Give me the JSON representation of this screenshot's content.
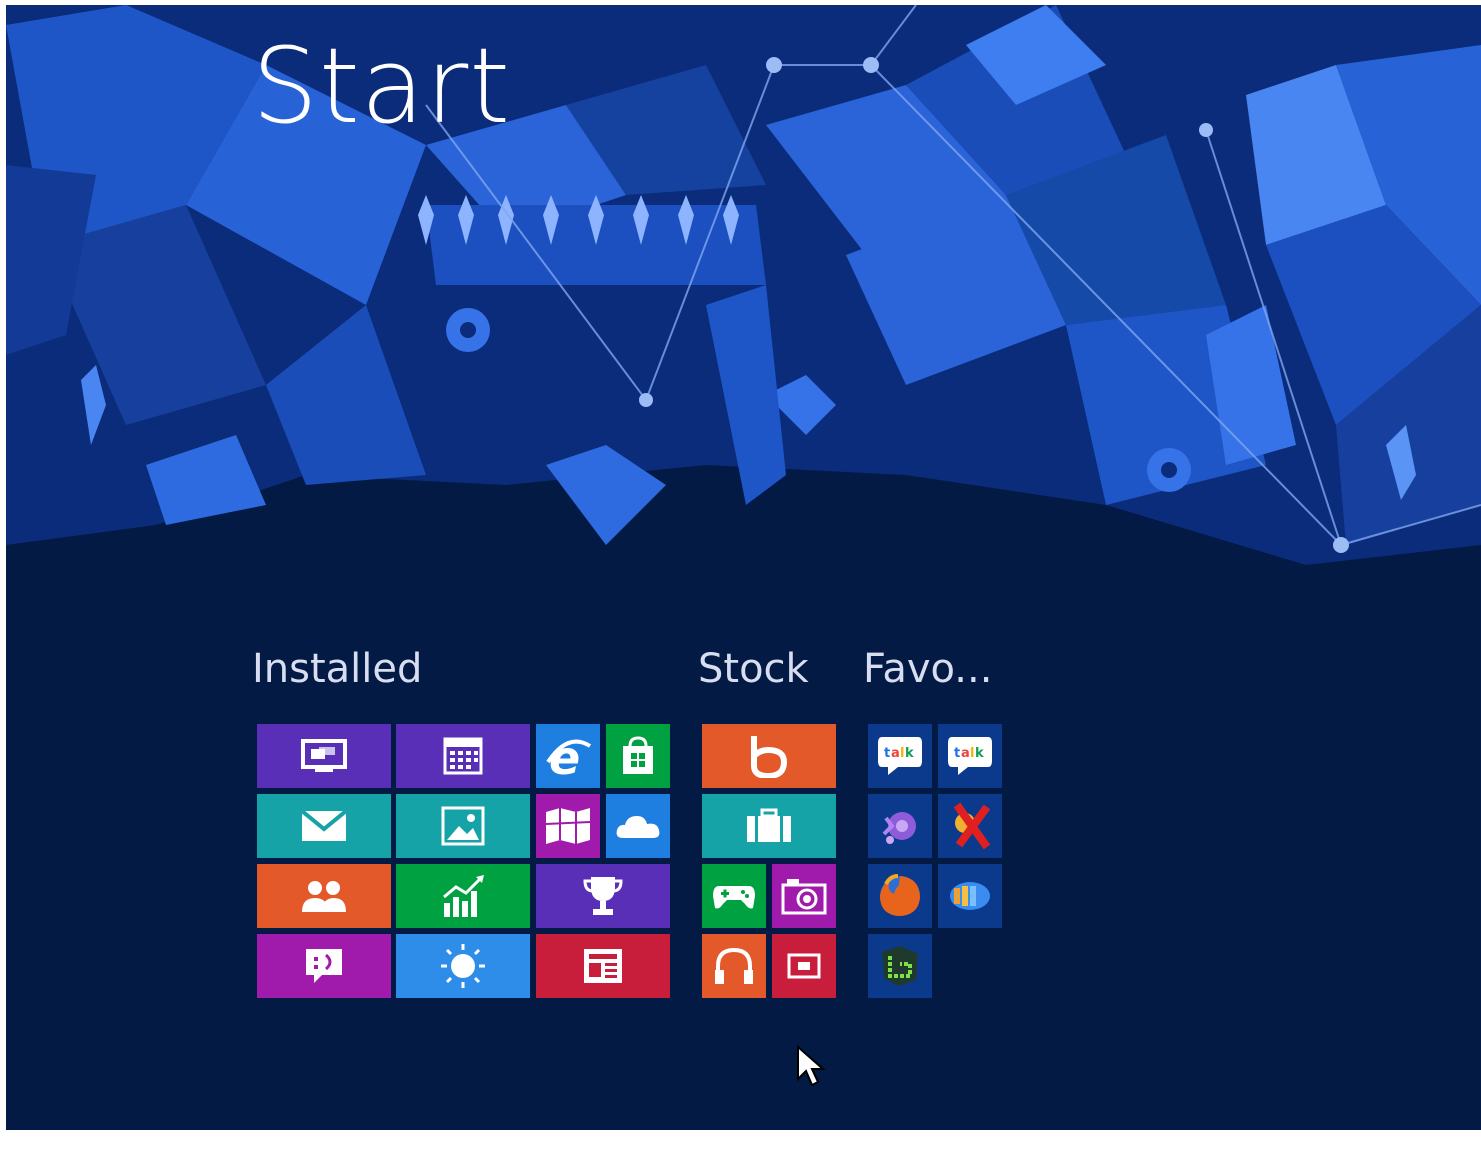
{
  "start": {
    "title": "Start"
  },
  "groups": [
    {
      "id": "installed",
      "label": "Installed"
    },
    {
      "id": "stock",
      "label": "Stock"
    },
    {
      "id": "favorites",
      "label": "Favo..."
    }
  ],
  "tiles": {
    "installed": [
      {
        "name": "desktop",
        "icon": "desktop-icon",
        "color": "#5a2fb7"
      },
      {
        "name": "calendar",
        "icon": "calendar-icon",
        "color": "#5a2fb7"
      },
      {
        "name": "internet-explorer",
        "icon": "ie-icon",
        "color": "#1f7fe0"
      },
      {
        "name": "store",
        "icon": "store-icon",
        "color": "#00a140"
      },
      {
        "name": "mail",
        "icon": "mail-icon",
        "color": "#16a3a8"
      },
      {
        "name": "photos",
        "icon": "photos-icon",
        "color": "#16a3a8"
      },
      {
        "name": "maps",
        "icon": "maps-icon",
        "color": "#a01bab"
      },
      {
        "name": "skydrive",
        "icon": "cloud-icon",
        "color": "#1f7fe0"
      },
      {
        "name": "people",
        "icon": "people-icon",
        "color": "#e4592a"
      },
      {
        "name": "finance",
        "icon": "chart-icon",
        "color": "#00a140"
      },
      {
        "name": "sports",
        "icon": "trophy-icon",
        "color": "#5a2fb7"
      },
      {
        "name": "messaging",
        "icon": "messaging-icon",
        "color": "#a01bab"
      },
      {
        "name": "weather",
        "icon": "sun-icon",
        "color": "#2e8de8"
      },
      {
        "name": "news",
        "icon": "news-icon",
        "color": "#c81e3c"
      }
    ],
    "stock": [
      {
        "name": "bing",
        "icon": "bing-icon",
        "color": "#e4592a"
      },
      {
        "name": "travel",
        "icon": "suitcase-icon",
        "color": "#16a3a8"
      },
      {
        "name": "games",
        "icon": "gamepad-icon",
        "color": "#00a140"
      },
      {
        "name": "camera",
        "icon": "camera-icon",
        "color": "#a01bab"
      },
      {
        "name": "music",
        "icon": "headphones-icon",
        "color": "#e4592a"
      },
      {
        "name": "video",
        "icon": "video-icon",
        "color": "#c81e3c"
      }
    ],
    "favorites": [
      {
        "name": "google-talk-1",
        "icon": "talk-icon",
        "color": "#0b3a8c"
      },
      {
        "name": "google-talk-2",
        "icon": "talk-icon",
        "color": "#0b3a8c"
      },
      {
        "name": "app-purple",
        "icon": "purple-app-icon",
        "color": "#0b3a8c"
      },
      {
        "name": "app-red-x",
        "icon": "red-x-app-icon",
        "color": "#0b3a8c"
      },
      {
        "name": "firefox",
        "icon": "firefox-icon",
        "color": "#0b3a8c"
      },
      {
        "name": "app-orb",
        "icon": "orb-app-icon",
        "color": "#0b3a8c"
      },
      {
        "name": "app-green",
        "icon": "green-app-icon",
        "color": "#0b3a8c"
      }
    ]
  }
}
